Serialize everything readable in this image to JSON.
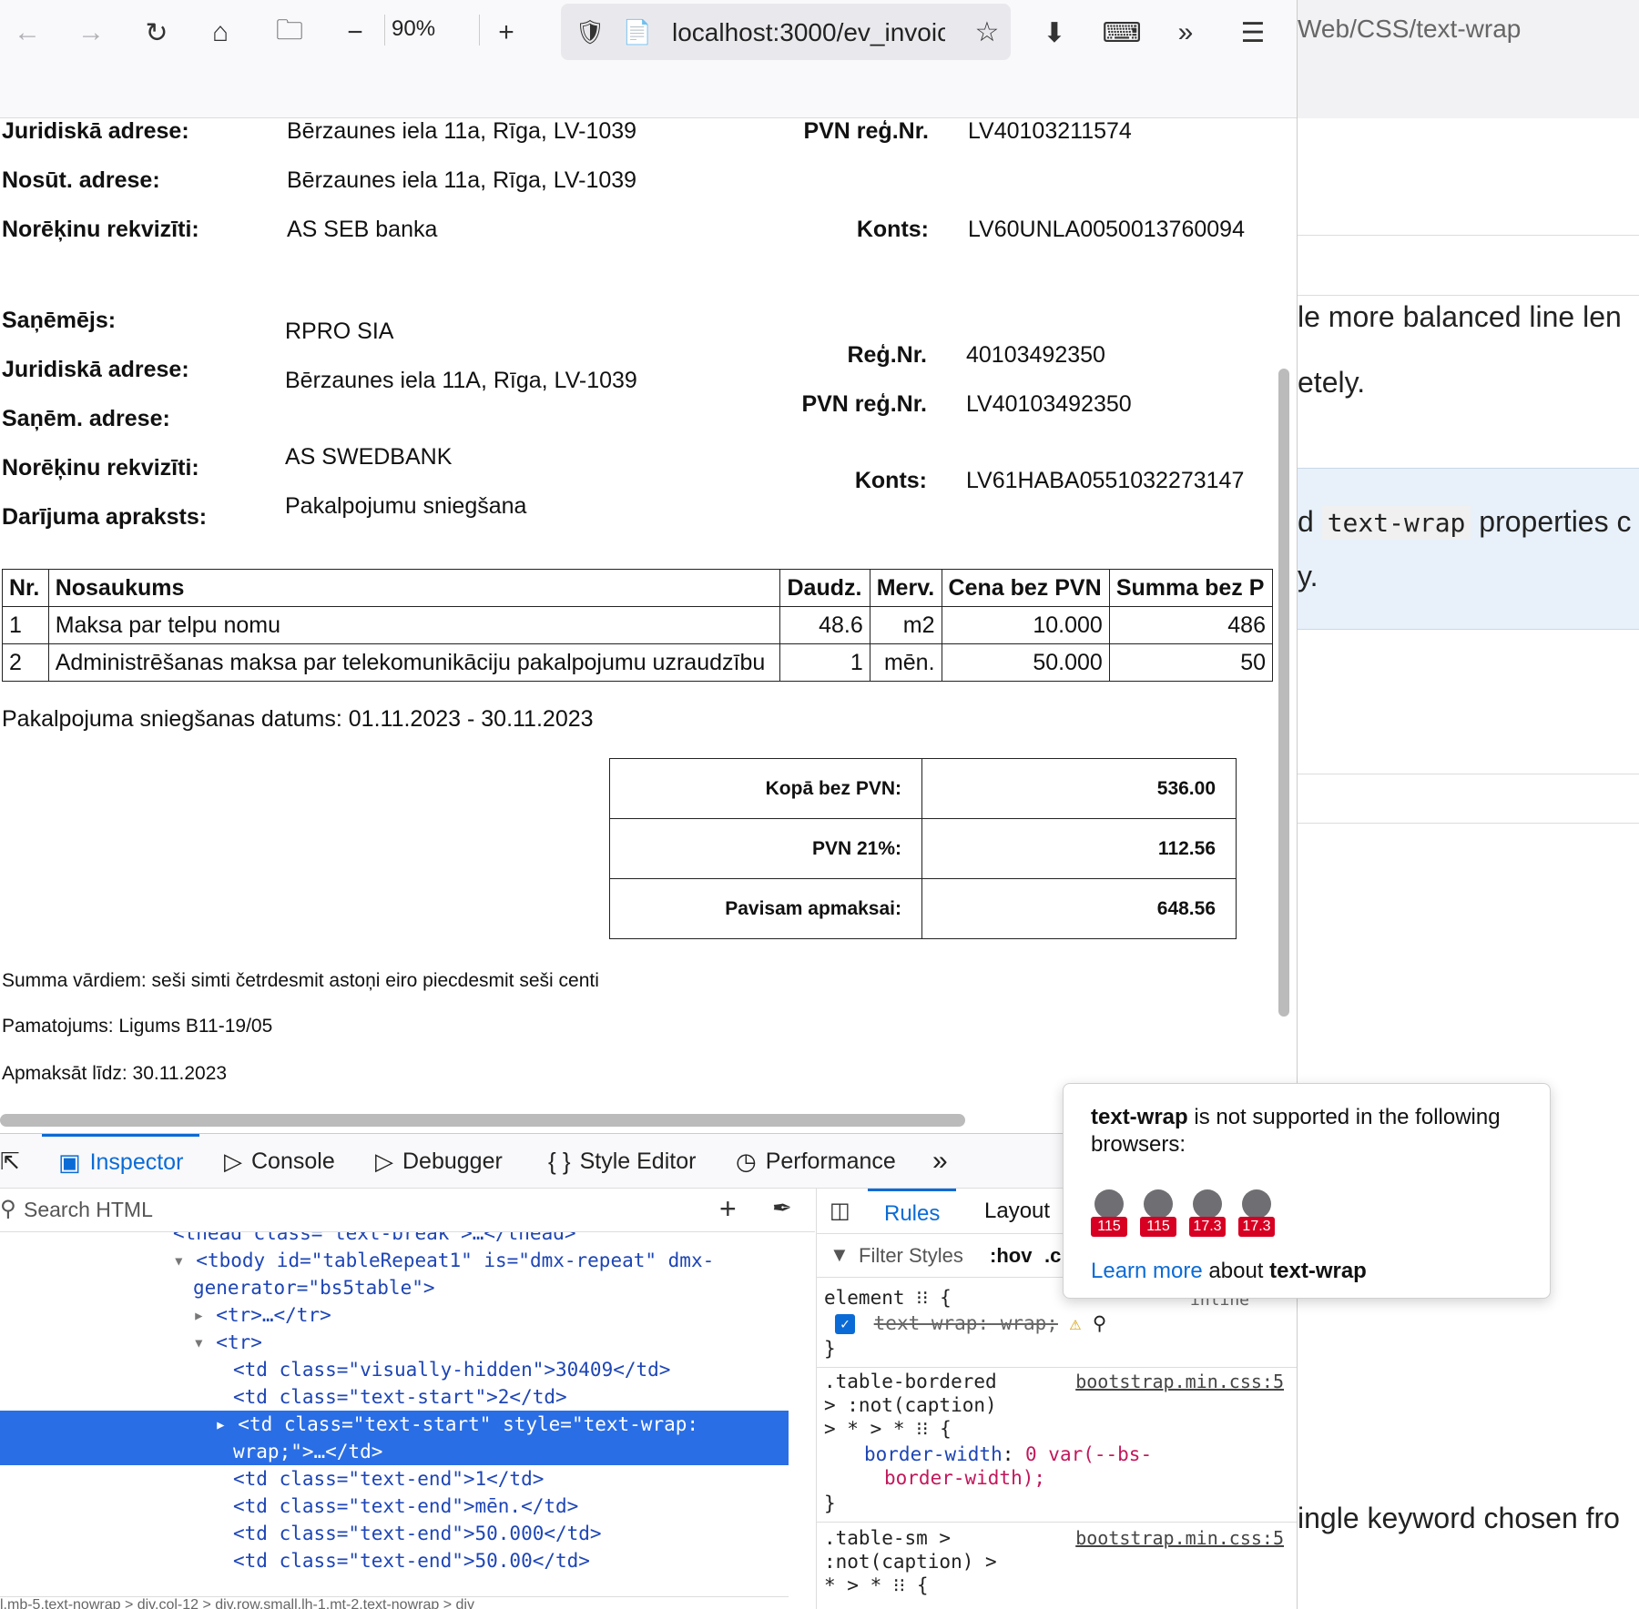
{
  "browser": {
    "zoom": "90%",
    "url_main": "localhost:3000/ev_invoic",
    "right_tab_url": "Web/CSS/text-wrap"
  },
  "right_page": {
    "line1": "le more balanced line len",
    "line2": "etely.",
    "note_before": "d",
    "note_code": "text-wrap",
    "note_after": "properties c",
    "note_line2": "y.",
    "line3": "ingle keyword chosen fro"
  },
  "invoice": {
    "sender": {
      "legal_address_label": "Juridiskā adrese:",
      "legal_address": "Bērzaunes iela 11a, Rīga, LV-1039",
      "vat_reg_label": "PVN reģ.Nr.",
      "vat_reg": "LV40103211574",
      "ship_address_label": "Nosūt. adrese:",
      "ship_address": "Bērzaunes iela 11a, Rīga, LV-1039",
      "bank_label": "Norēķinu rekvizīti:",
      "bank": "AS SEB banka",
      "account_label": "Konts:",
      "account": "LV60UNLA0050013760094"
    },
    "receiver": {
      "receiver_label": "Saņēmējs:",
      "receiver": "RPRO SIA",
      "legal_address_label": "Juridiskā adrese:",
      "legal_address": "Bērzaunes iela 11A, Rīga, LV-1039",
      "reg_label": "Reģ.Nr.",
      "reg": "40103492350",
      "vat_reg_label": "PVN reģ.Nr.",
      "vat_reg": "LV40103492350",
      "recv_address_label": "Saņēm. adrese:",
      "bank_label": "Norēķinu rekvizīti:",
      "bank": "AS SWEDBANK",
      "account_label": "Konts:",
      "account": "LV61HABA0551032273147",
      "description_label": "Darījuma apraksts:",
      "description": "Pakalpojumu sniegšana"
    },
    "table": {
      "headers": [
        "Nr.",
        "Nosaukums",
        "Daudz.",
        "Merv.",
        "Cena bez PVN",
        "Summa bez P"
      ],
      "rows": [
        [
          "1",
          "Maksa par telpu nomu",
          "48.6",
          "m2",
          "10.000",
          "486"
        ],
        [
          "2",
          "Administrēšanas maksa par telekomunikāciju pakalpojumu uzraudzību",
          "1",
          "mēn.",
          "50.000",
          "50"
        ]
      ]
    },
    "service_date": "Pakalpojuma sniegšanas datums: 01.11.2023 - 30.11.2023",
    "totals": [
      {
        "label": "Kopā bez PVN:",
        "value": "536.00"
      },
      {
        "label": "PVN 21%:",
        "value": "112.56"
      },
      {
        "label": "Pavisam apmaksai:",
        "value": "648.56"
      }
    ],
    "sum_words": "Summa vārdiem: seši simti četrdesmit astoņi eiro piecdesmit seši centi",
    "basis": "Pamatojums: Ligums B11-19/05",
    "pay_until": "Apmaksāt līdz: 30.11.2023"
  },
  "devtools": {
    "tabs": [
      "Inspector",
      "Console",
      "Debugger",
      "Style Editor",
      "Performance"
    ],
    "search_placeholder": "Search HTML",
    "rules_tabs": [
      "Rules",
      "Layout"
    ],
    "filter_placeholder": "Filter Styles",
    "hov": ":hov",
    "cls": ".c",
    "markup": {
      "thead": "<thead class=\"text-break\">…</thead>",
      "tbody_1": "<tbody id=\"tableRepeat1\" is=\"dmx-repeat\" dmx-",
      "tbody_2": "generator=\"bs5table\">",
      "tr_collapsed": "<tr>…</tr>",
      "tr_open": "<tr>",
      "td1": "<td class=\"visually-hidden\">30409</td>",
      "td2": "<td class=\"text-start\">2</td>",
      "td3_a": "<td class=\"text-start\" style=\"text-wrap:",
      "td3_b": "wrap;\">…</td>",
      "td4": "<td class=\"text-end\">1</td>",
      "td5": "<td class=\"text-end\">mēn.</td>",
      "td6": "<td class=\"text-end\">50.000</td>",
      "td7": "<td class=\"text-end\">50.00</td>"
    },
    "breadcrumbs": "l.mb-5.text-nowrap  >  div.col-12  >  div.row.small.lh-1.mt-2.text-nowrap  >  div",
    "rules": {
      "element": "element ⁝⁝ {",
      "element_inline": "inline",
      "decl_strike": "text-wrap: wrap;",
      "close": "}",
      "r2_sel_1": ".table-bordered",
      "r2_src": "bootstrap.min.css:5",
      "r2_sel_2": "> :not(caption)",
      "r2_sel_3": "> * > * ⁝⁝ {",
      "r2_prop": "border-width",
      "r2_val_1": "0 var(--bs-",
      "r2_val_2": "border-width);",
      "r3_sel_1": ".table-sm >",
      "r3_src": "bootstrap.min.css:5",
      "r3_sel_2": ":not(caption) >",
      "r3_sel_3": "* > * ⁝⁝ {"
    }
  },
  "tooltip": {
    "prop": "text-wrap",
    "msg": " is not supported in the following browsers:",
    "browsers": [
      {
        "name": "firefox-icon",
        "version": "115"
      },
      {
        "name": "firefox-android-icon",
        "version": "115"
      },
      {
        "name": "safari-icon",
        "version": "17.3"
      },
      {
        "name": "safari-ios-icon",
        "version": "17.3"
      }
    ],
    "learn_more": "Learn more",
    "about": " about ",
    "about_prop": "text-wrap"
  }
}
